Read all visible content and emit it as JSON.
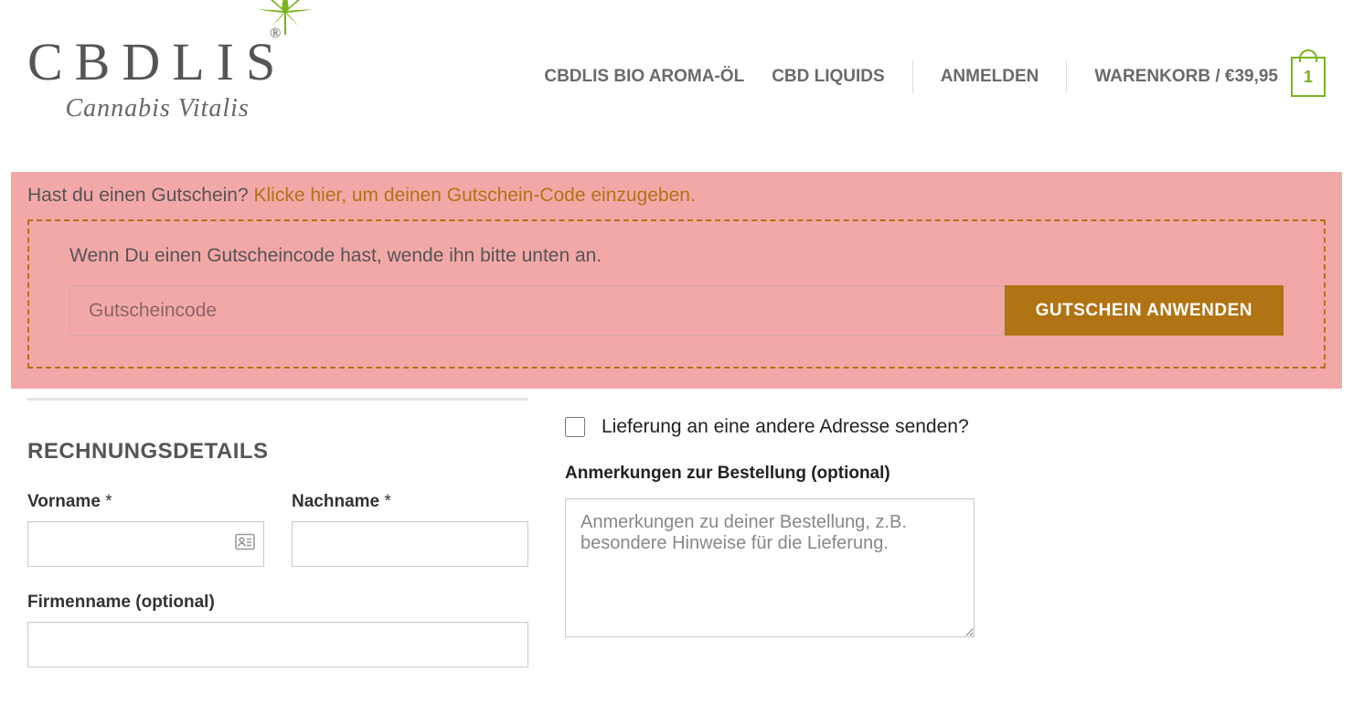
{
  "logo": {
    "main": "CBDLIS",
    "sub": "Cannabis Vitalis"
  },
  "nav": {
    "item1": "CBDLIS BIO AROMA-ÖL",
    "item2": "CBD LIQUIDS",
    "login": "ANMELDEN",
    "cart_label": "WARENKORB / ",
    "cart_price": "€39,95",
    "cart_count": "1"
  },
  "coupon": {
    "prompt_prefix": "Hast du einen Gutschein? ",
    "prompt_link": "Klicke hier, um deinen Gutschein-Code einzugeben.",
    "box_msg": "Wenn Du einen Gutscheincode hast, wende ihn bitte unten an.",
    "placeholder": "Gutscheincode",
    "button": "GUTSCHEIN ANWENDEN"
  },
  "billing": {
    "title": "RECHNUNGSDETAILS",
    "first_name": "Vorname ",
    "last_name": "Nachname ",
    "company": "Firmenname (optional)",
    "req": "*"
  },
  "shipping": {
    "diff_label": "Lieferung an eine andere Adresse senden?",
    "notes_label": "Anmerkungen zur Bestellung (optional)",
    "notes_placeholder": "Anmerkungen zu deiner Bestellung, z.B. besondere Hinweise für die Lieferung."
  }
}
